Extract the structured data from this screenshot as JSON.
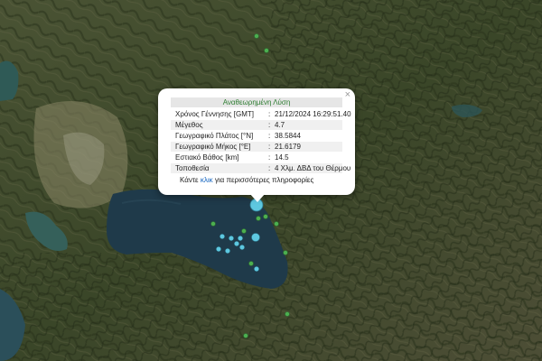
{
  "popup": {
    "title": "Αναθεωρημένη Λύση",
    "close_symbol": "×",
    "rows": [
      {
        "label": "Χρόνος Γέννησης [GMT]",
        "value": "21/12/2024 16:29:51.40"
      },
      {
        "label": "Μέγεθος",
        "value": "4.7"
      },
      {
        "label": "Γεωγραφικό Πλάτος [°N]",
        "value": "38.5844"
      },
      {
        "label": "Γεωγραφικό Μήκος [°E]",
        "value": "21.6179"
      },
      {
        "label": "Εστιακό Βάθος [km]",
        "value": "14.5"
      },
      {
        "label": "Τοποθεσία",
        "value": "4 Χλμ. ΔΒΔ του Θέρμου"
      }
    ],
    "more_prefix": "Κάντε ",
    "more_link": "κλικ",
    "more_suffix": " για περισσότερες πληροφορίες"
  },
  "colors": {
    "quake_recent": "#5ec8e0",
    "quake_older": "#4caf50",
    "lake": "#1f3a4a",
    "terrain": "#3f4a2c"
  }
}
